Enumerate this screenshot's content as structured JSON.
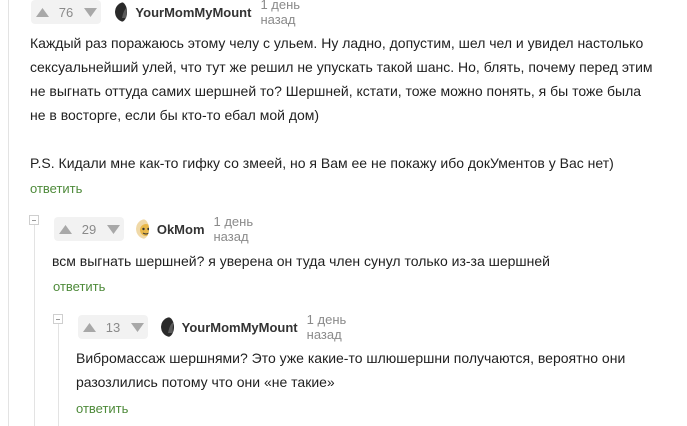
{
  "comments": [
    {
      "rating": "76",
      "author": "YourMomMyMount",
      "time": "1 день назад",
      "lines": [
        "Каждый раз поражаюсь этому челу с ульем. Ну ладно, допустим, шел чел и увидел настолько",
        "сексуальнейший улей, что тут же решил не упускать такой шанс. Но, блять, почему перед этим",
        "не выгнать оттуда самих шершней то? Шершней, кстати, тоже можно понять, я бы тоже была",
        "не в восторге, если бы кто-то ебал мой дом)",
        "",
        "P.S. Кидали мне как-то гифку со змеей, но я Вам ее не покажу ибо докУментов у Вас нет)"
      ],
      "reply": "ответить"
    },
    {
      "rating": "29",
      "author": "OkMom",
      "time": "1 день назад",
      "lines": [
        "всм выгнать шершней? я уверена он туда член сунул только из-за шершней"
      ],
      "reply": "ответить"
    },
    {
      "rating": "13",
      "author": "YourMomMyMount",
      "time": "1 день назад",
      "lines": [
        "Вибромассаж шершнями? Это уже какие-то шлюшершни получаются, вероятно они",
        "разозлились потому что они «не такие»"
      ],
      "reply": "ответить"
    }
  ],
  "icons": {
    "upvote": "arrow-up-icon",
    "downvote": "arrow-down-icon",
    "collapse": "collapse-icon"
  },
  "colors": {
    "reply_link": "#4e8a3a",
    "rating_bg": "#f2f2f2",
    "thread_line": "#e3e3e3"
  }
}
